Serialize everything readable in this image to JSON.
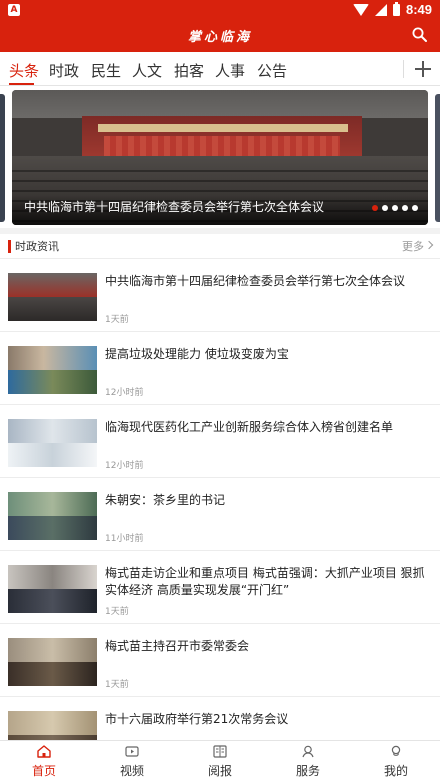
{
  "status_bar": {
    "time": "8:49",
    "app_badge": "A"
  },
  "app_bar": {
    "title": "掌心临海"
  },
  "tabs": [
    {
      "label": "头条",
      "active": true
    },
    {
      "label": "时政"
    },
    {
      "label": "民生"
    },
    {
      "label": "人文"
    },
    {
      "label": "拍客"
    },
    {
      "label": "人事"
    },
    {
      "label": "公告"
    }
  ],
  "banner": {
    "caption": "中共临海市第十四届纪律检查委员会举行第七次全体会议",
    "slide_count": 5,
    "active_slide": 1
  },
  "section": {
    "title": "时政资讯",
    "more_label": "更多"
  },
  "news": [
    {
      "title": "中共临海市第十四届纪律检查委员会举行第七次全体会议",
      "time": "1天前"
    },
    {
      "title": "提高垃圾处理能力 使垃圾变废为宝",
      "time": "12小时前"
    },
    {
      "title": "临海现代医药化工产业创新服务综合体入榜省创建名单",
      "time": "12小时前"
    },
    {
      "title": "朱朝安：茶乡里的书记",
      "time": "11小时前"
    },
    {
      "title": "梅式苗走访企业和重点项目 梅式苗强调：大抓产业项目 狠抓实体经济 高质量实现发展“开门红”",
      "time": "1天前"
    },
    {
      "title": "梅式苗主持召开市委常委会",
      "time": "1天前"
    },
    {
      "title": "市十六届政府举行第21次常务会议",
      "time": ""
    }
  ],
  "bottom_nav": [
    {
      "label": "首页",
      "icon": "home-icon",
      "active": true
    },
    {
      "label": "视频",
      "icon": "video-icon"
    },
    {
      "label": "阅报",
      "icon": "newspaper-icon"
    },
    {
      "label": "服务",
      "icon": "service-icon"
    },
    {
      "label": "我的",
      "icon": "profile-icon"
    }
  ],
  "colors": {
    "accent": "#d8220d"
  }
}
